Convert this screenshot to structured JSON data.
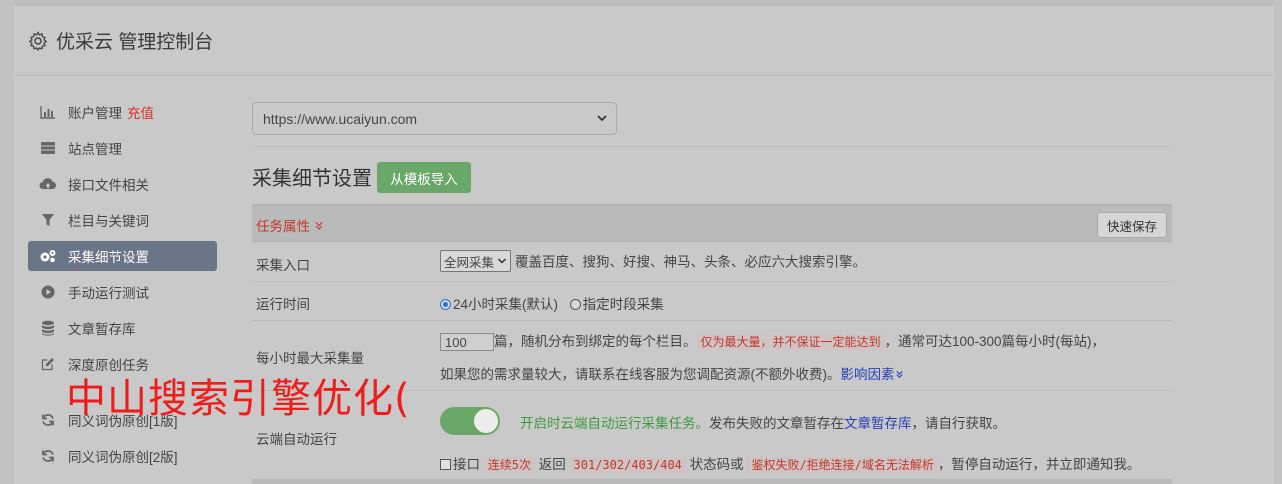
{
  "header": {
    "title": "优采云 管理控制台",
    "icon": "gear-icon"
  },
  "sidebar": {
    "items": [
      {
        "label": "账户管理",
        "badge": "充值",
        "icon": "bar-chart-icon"
      },
      {
        "label": "站点管理",
        "icon": "server-icon"
      },
      {
        "label": "接口文件相关",
        "icon": "cloud-upload-icon"
      },
      {
        "label": "栏目与关键词",
        "icon": "filter-icon"
      },
      {
        "label": "采集细节设置",
        "icon": "cogs-icon",
        "active": true
      },
      {
        "label": "手动运行测试",
        "icon": "play-circle-icon"
      },
      {
        "label": "文章暂存库",
        "icon": "database-icon"
      },
      {
        "label": "深度原创任务",
        "icon": "edit-icon"
      },
      {
        "label": "同义词伪原创[1版]",
        "icon": "refresh-icon"
      },
      {
        "label": "同义词伪原创[2版]",
        "icon": "refresh-icon"
      }
    ]
  },
  "site_select": {
    "value": "https://www.ucaiyun.com"
  },
  "section": {
    "title": "采集细节设置",
    "import_button": "从模板导入"
  },
  "panel": {
    "label": "任务属性",
    "label_icon": "double-chevron-down-icon",
    "save_button": "快速保存"
  },
  "rows": {
    "entry": {
      "label": "采集入口",
      "select_value": "全网采集",
      "desc": "覆盖百度、搜狗、好搜、神马、头条、必应六大搜索引擎。"
    },
    "time": {
      "label": "运行时间",
      "option1": "24小时采集(默认)",
      "option2": "指定时段采集"
    },
    "max": {
      "label": "每小时最大采集量",
      "value": "100",
      "text1": "篇，随机分布到绑定的每个栏目。",
      "warn": "仅为最大量，并不保证一定能达到",
      "text2": "，通常可达100-300篇每小时(每站)，",
      "text3": "如果您的需求量较大，请联系在线客服为您调配资源(不额外收费)。",
      "link": "影响因素"
    },
    "cloud": {
      "label": "云端自动运行",
      "green_text": "开启时云端自动运行采集任务。",
      "text1": "发布失败的文章暂存在",
      "link": "文章暂存库",
      "text2": "，请自行获取。",
      "check_label": "接口",
      "warn1": "连续5次",
      "text3": "返回",
      "warn2": "301/302/403/404",
      "text4": "状态码或",
      "warn3": "鉴权失败/拒绝连接/域名无法解析",
      "text5": "，暂停自动运行，并立即通知我。"
    }
  },
  "watermark": "中山搜索引擎优化("
}
